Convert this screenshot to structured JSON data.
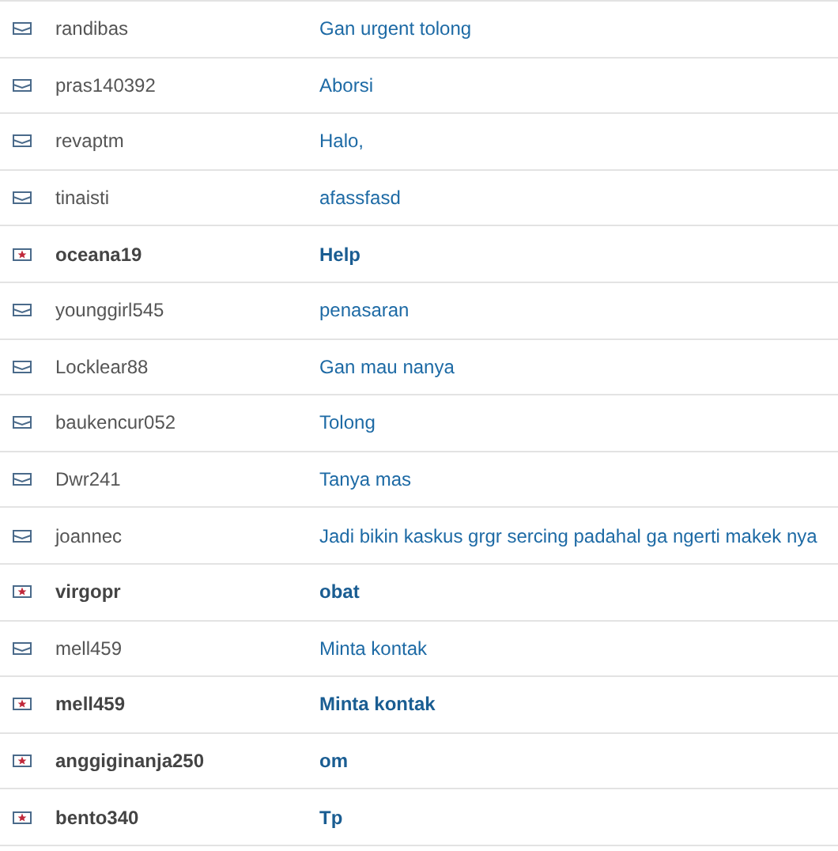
{
  "messages": [
    {
      "sender": "randibas",
      "subject": "Gan urgent tolong",
      "unread": false
    },
    {
      "sender": "pras140392",
      "subject": "Aborsi",
      "unread": false
    },
    {
      "sender": "revaptm",
      "subject": "Halo,",
      "unread": false
    },
    {
      "sender": "tinaisti",
      "subject": "afassfasd",
      "unread": false
    },
    {
      "sender": "oceana19",
      "subject": "Help",
      "unread": true
    },
    {
      "sender": "younggirl545",
      "subject": "penasaran",
      "unread": false
    },
    {
      "sender": "Locklear88",
      "subject": "Gan mau nanya",
      "unread": false
    },
    {
      "sender": "baukencur052",
      "subject": "Tolong",
      "unread": false
    },
    {
      "sender": "Dwr241",
      "subject": "Tanya mas",
      "unread": false
    },
    {
      "sender": "joannec",
      "subject": "Jadi bikin kaskus grgr sercing padahal ga ngerti makek nya",
      "unread": false
    },
    {
      "sender": "virgopr",
      "subject": "obat",
      "unread": true
    },
    {
      "sender": "mell459",
      "subject": "Minta kontak",
      "unread": false
    },
    {
      "sender": "mell459",
      "subject": "Minta kontak",
      "unread": true
    },
    {
      "sender": "anggiginanja250",
      "subject": "om",
      "unread": true
    },
    {
      "sender": "bento340",
      "subject": "Tp",
      "unread": true
    }
  ]
}
